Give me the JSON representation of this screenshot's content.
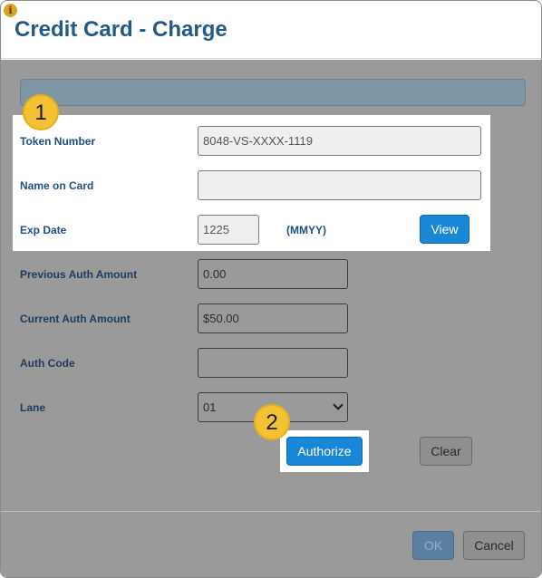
{
  "dialog": {
    "title": "Credit Card - Charge"
  },
  "form": {
    "token_label": "Token Number",
    "token_value": "8048-VS-XXXX-1119",
    "name_label": "Name on Card",
    "name_value": "",
    "exp_label": "Exp Date",
    "exp_value": "1225",
    "exp_hint": "(MMYY)",
    "view_label": "View",
    "prev_auth_label": "Previous Auth Amount",
    "prev_auth_value": "0.00",
    "curr_auth_label": "Current Auth Amount",
    "curr_auth_value": "$50.00",
    "auth_code_label": "Auth Code",
    "auth_code_value": "",
    "lane_label": "Lane",
    "lane_value": "01",
    "authorize_label": "Authorize",
    "clear_label": "Clear"
  },
  "footer": {
    "ok_label": "OK",
    "cancel_label": "Cancel"
  },
  "callouts": {
    "one": "1",
    "two": "2"
  },
  "colors": {
    "accent": "#1a86d6",
    "title": "#1f5a8a",
    "badge": "#f2c233"
  }
}
